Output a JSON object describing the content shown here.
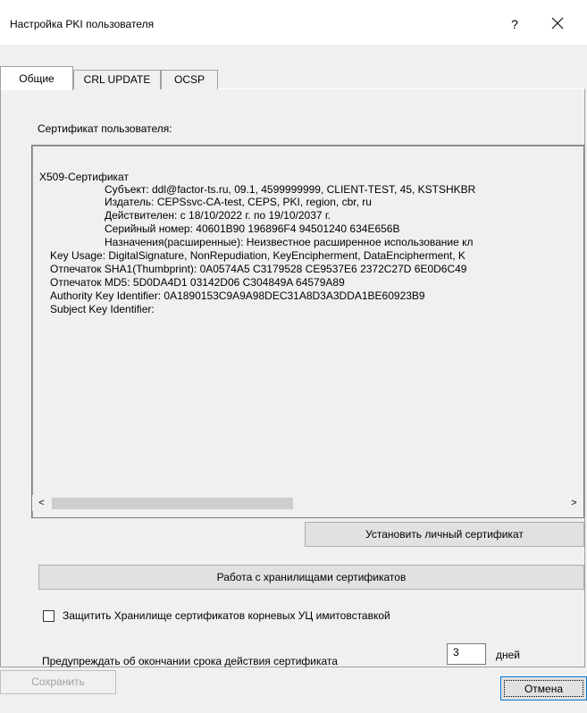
{
  "window": {
    "title": "Настройка PKI пользователя",
    "help": "?",
    "close": "✕"
  },
  "tabs": [
    "Общие",
    "CRL UPDATE",
    "OCSP"
  ],
  "cert_label": "Сертификат пользователя:",
  "cert_lines": [
    "X509-Сертификат",
    "Субъект: ddl@factor-ts.ru, 09.1, 4599999999, CLIENT-TEST, 45, KSTSHKBR",
    "Издатель: CEPSsvc-CA-test, CEPS, PKI, region, cbr, ru",
    "Действителен: с 18/10/2022 г. по 19/10/2037 г.",
    "Серийный номер: 40601B90 196896F4 94501240 634E656B",
    "Назначения(расширенные): Неизвестное расширенное использование кл",
    "Key Usage: DigitalSignature, NonRepudiation, KeyEncipherment, DataEncipherment, K",
    "Отпечаток SHA1(Thumbprint): 0A0574A5 C3179528 CE9537E6 2372C27D 6E0D6C49",
    "Отпечаток MD5: 5D0DA4D1 03142D06 C304849A 64579A89",
    "Authority Key Identifier: 0A1890153C9A9A98DEC31A8D3A3DDA1BE60923B9",
    "Subject Key Identifier:"
  ],
  "scroll": {
    "left": "<",
    "right": ">"
  },
  "buttons": {
    "install": "Установить личный сертификат",
    "stores": "Работа с хранилищами сертификатов",
    "save": "Сохранить",
    "cancel": "Отмена"
  },
  "protect_label": "Защитить Хранилище сертификатов корневых УЦ имитовставкой",
  "warn": {
    "label": "Предупреждать об окончании срока действия сертификата",
    "days_value": "3",
    "days_unit": "дней"
  }
}
